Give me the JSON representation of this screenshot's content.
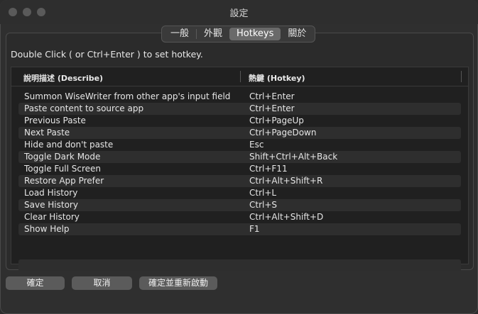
{
  "window": {
    "title": "設定"
  },
  "tabs": [
    {
      "label": "一般",
      "active": false
    },
    {
      "label": "外觀",
      "active": false
    },
    {
      "label": "Hotkeys",
      "active": true
    },
    {
      "label": "關於",
      "active": false
    }
  ],
  "hint": "Double Click ( or Ctrl+Enter ) to set hotkey.",
  "table": {
    "headers": {
      "describe": "說明描述 (Describe)",
      "hotkey": "熱鍵 (Hotkey)"
    },
    "rows": [
      {
        "describe": "Summon WiseWriter from other app's input field",
        "hotkey": "Ctrl+Enter"
      },
      {
        "describe": "Paste content to source app",
        "hotkey": "Ctrl+Enter"
      },
      {
        "describe": "Previous Paste",
        "hotkey": "Ctrl+PageUp"
      },
      {
        "describe": "Next Paste",
        "hotkey": "Ctrl+PageDown"
      },
      {
        "describe": "Hide and don't paste",
        "hotkey": "Esc"
      },
      {
        "describe": "Toggle Dark Mode",
        "hotkey": "Shift+Ctrl+Alt+Back"
      },
      {
        "describe": "Toggle Full Screen",
        "hotkey": "Ctrl+F11"
      },
      {
        "describe": "Restore App Prefer",
        "hotkey": "Ctrl+Alt+Shift+R"
      },
      {
        "describe": "Load History",
        "hotkey": "Ctrl+L"
      },
      {
        "describe": "Save History",
        "hotkey": "Ctrl+S"
      },
      {
        "describe": "Clear History",
        "hotkey": "Ctrl+Alt+Shift+D"
      },
      {
        "describe": "Show Help",
        "hotkey": "F1"
      }
    ]
  },
  "buttons": {
    "ok": "確定",
    "cancel": "取消",
    "restart": "確定並重新啟動"
  }
}
